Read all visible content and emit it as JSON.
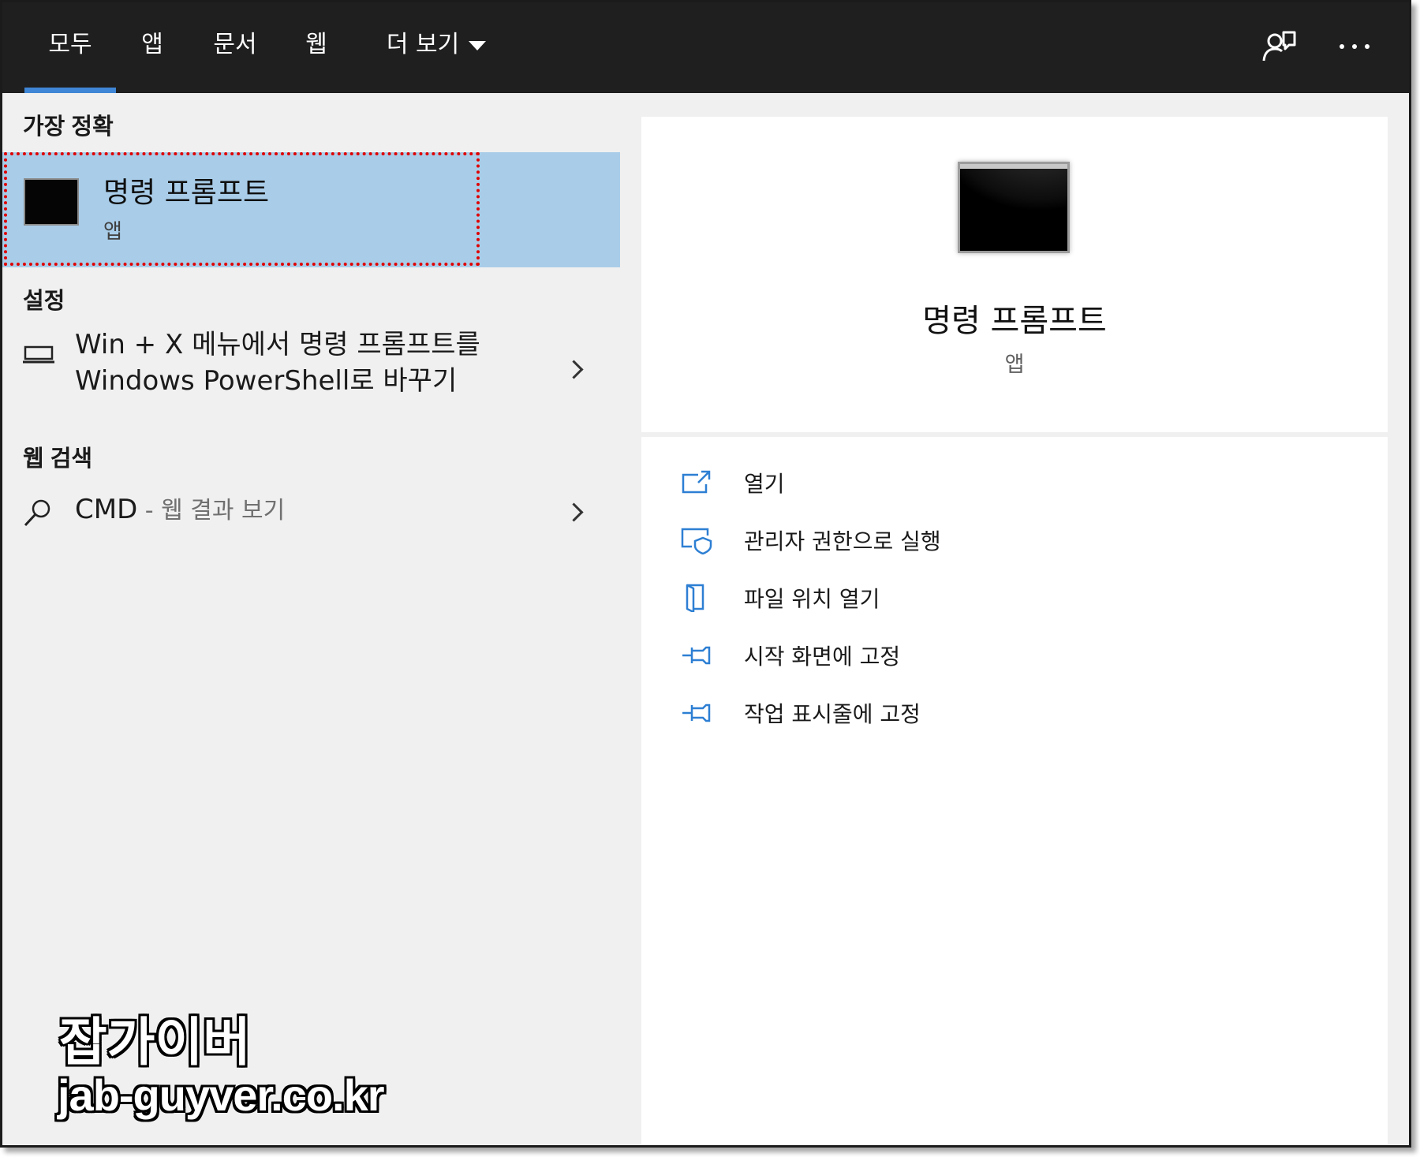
{
  "tabs": [
    {
      "label": "모두",
      "active": true
    },
    {
      "label": "앱"
    },
    {
      "label": "문서"
    },
    {
      "label": "웹"
    },
    {
      "label": "더 보기"
    }
  ],
  "top_icons": [
    "feedback-icon",
    "more-options-icon"
  ],
  "left": {
    "best_match": {
      "section": "가장 정확",
      "title": "명령 프롬프트",
      "subtitle": "앱",
      "icon": "command-prompt-icon",
      "highlight_color": "#a9cde9"
    },
    "settings": {
      "section": "설정",
      "line1": "Win + X 메뉴에서 명령 프롬프트를",
      "line2": "Windows PowerShell로 바꾸기",
      "icon": "laptop-icon"
    },
    "web": {
      "section": "웹 검색",
      "query": "CMD",
      "suffix": " - 웹 결과 보기",
      "icon": "search-icon"
    }
  },
  "preview": {
    "title": "명령 프롬프트",
    "subtitle": "앱",
    "icon": "command-prompt-icon"
  },
  "actions": [
    {
      "label": "열기",
      "icon": "open-icon"
    },
    {
      "label": "관리자 권한으로 실행",
      "icon": "admin-shield-icon"
    },
    {
      "label": "파일 위치 열기",
      "icon": "folder-icon"
    },
    {
      "label": "시작 화면에 고정",
      "icon": "pin-icon"
    },
    {
      "label": "작업 표시줄에 고정",
      "icon": "pin-icon"
    }
  ],
  "colors": {
    "accent": "#3f86d6",
    "topbar": "#1f1f1f",
    "icon_blue": "#2d7fd3"
  },
  "watermark": {
    "title": "잡가이버",
    "url": "jab-guyver.co.kr"
  }
}
